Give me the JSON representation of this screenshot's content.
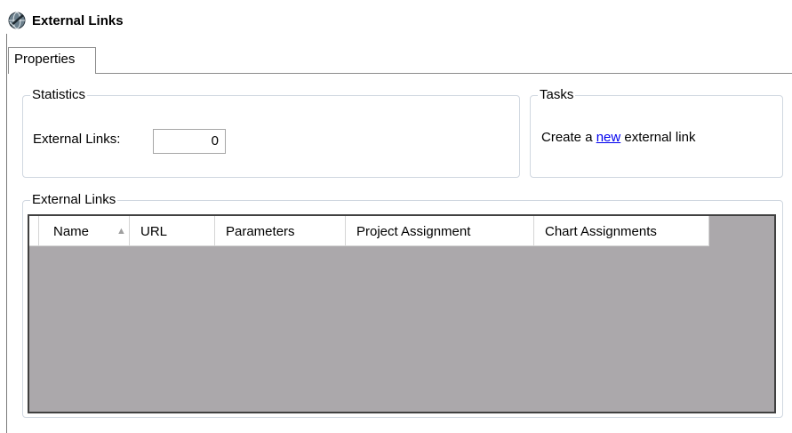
{
  "header": {
    "title": "External Links",
    "icon": "links-icon"
  },
  "tabs": [
    {
      "label": "Properties",
      "active": true
    }
  ],
  "statistics": {
    "group_title": "Statistics",
    "external_links_label": "External Links:",
    "external_links_value": "0"
  },
  "tasks": {
    "group_title": "Tasks",
    "text_before": "Create a ",
    "link_text": "new",
    "text_after": " external link"
  },
  "links_grid": {
    "group_title": "External Links",
    "columns": [
      "Name",
      "URL",
      "Parameters",
      "Project Assignment",
      "Chart Assignments"
    ],
    "sorted_column": "Name",
    "sort_direction": "ascending",
    "rows": []
  },
  "colors": {
    "grid_background": "#aba8ab",
    "link": "#0000ee",
    "group_border": "#d0d7e0"
  }
}
